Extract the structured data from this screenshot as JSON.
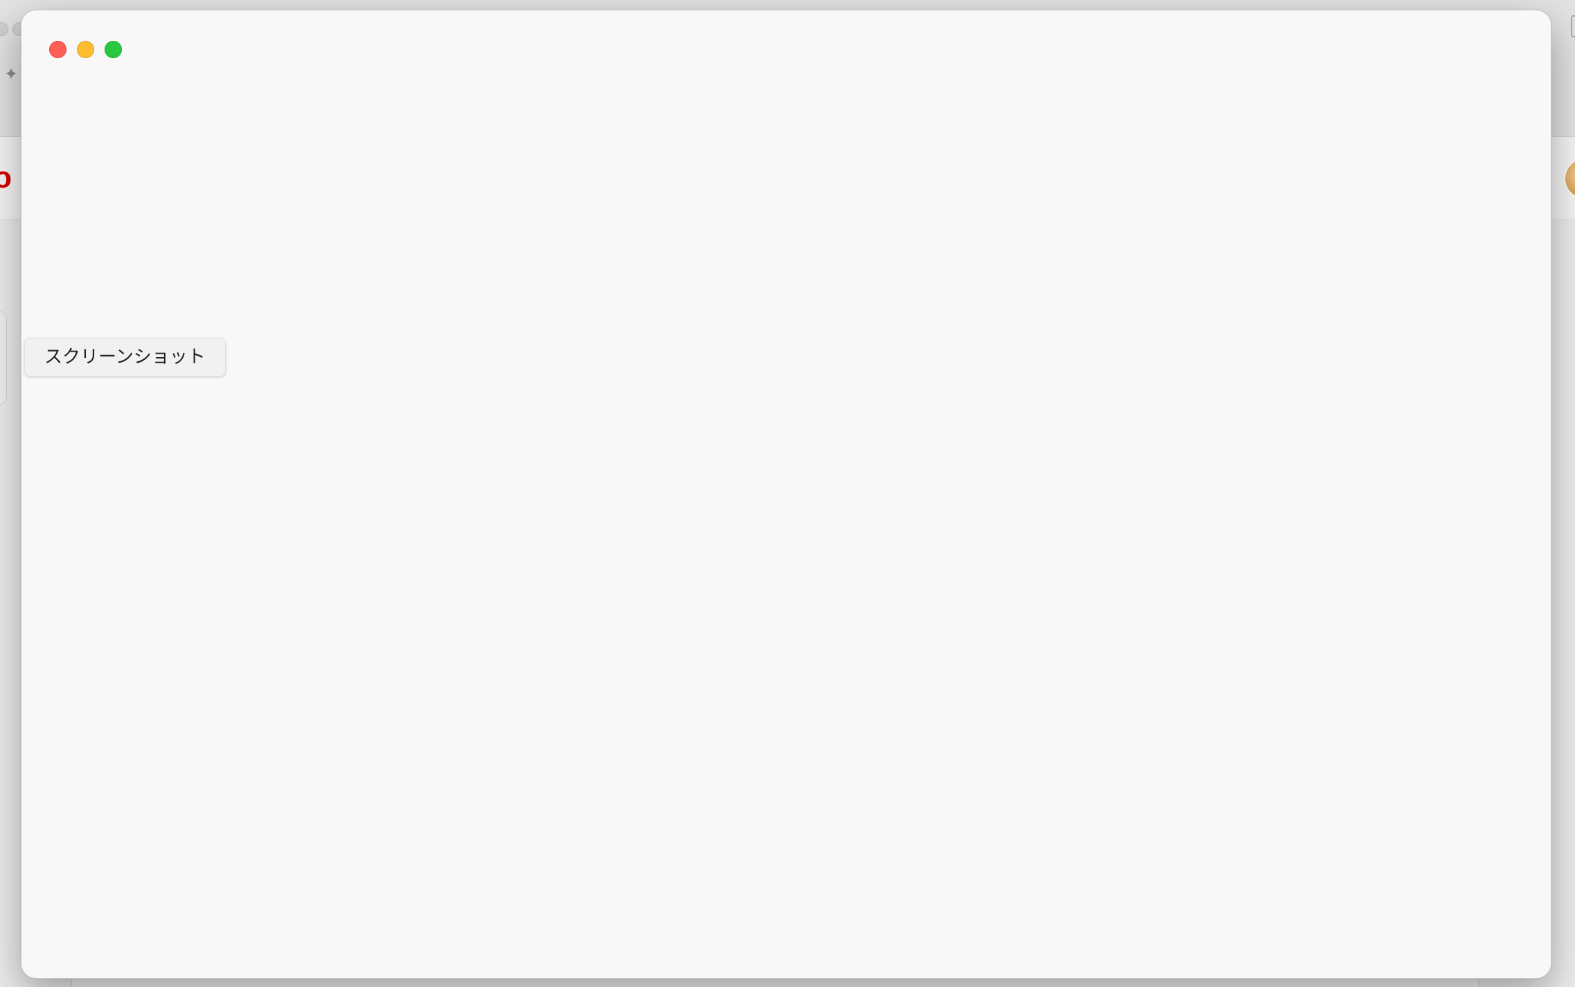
{
  "background_app": {
    "logo_text": "lo",
    "logo_color": "#d40000"
  },
  "window": {
    "background": "#f8f8f8",
    "traffic_lights": {
      "close_color": "#ff5f57",
      "minimize_color": "#febc2e",
      "zoom_color": "#28c840"
    },
    "screenshot_button_label": "スクリーンショット"
  }
}
